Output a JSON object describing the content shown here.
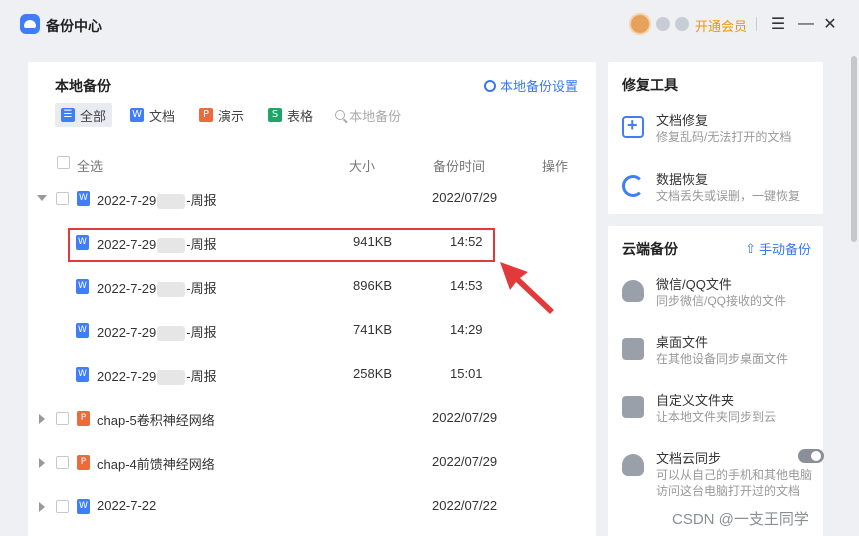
{
  "app": {
    "title": "备份中心"
  },
  "titlebar": {
    "vip_label": "开通会员",
    "menu_icon": "menu-icon",
    "min_icon": "minimize-icon",
    "close_icon": "close-icon"
  },
  "local": {
    "title": "本地备份",
    "settings_label": "本地备份设置",
    "filters": [
      {
        "label": "全部",
        "icon": "list-icon",
        "color": "#3f7ef8",
        "glyph": "☰",
        "active": true
      },
      {
        "label": "文档",
        "icon": "word-icon",
        "color": "#3f7ef8",
        "glyph": "W",
        "active": false
      },
      {
        "label": "演示",
        "icon": "ppt-icon",
        "color": "#ee6a3c",
        "glyph": "P",
        "active": false
      },
      {
        "label": "表格",
        "icon": "sheet-icon",
        "color": "#1fa568",
        "glyph": "S",
        "active": false
      }
    ],
    "search_placeholder": "本地备份",
    "columns": {
      "select_all": "全选",
      "size": "大小",
      "time": "备份时间",
      "ops": "操作"
    },
    "rows": [
      {
        "name_pre": "2022-7-29",
        "name_post": "-周报",
        "size": "",
        "time": "2022/07/29",
        "type": "word",
        "level": 0,
        "caret": "open"
      },
      {
        "name_pre": "2022-7-29",
        "name_post": "-周报",
        "size": "941KB",
        "time": "14:52",
        "type": "word",
        "level": 1,
        "caret": ""
      },
      {
        "name_pre": "2022-7-29",
        "name_post": "-周报",
        "size": "896KB",
        "time": "14:53",
        "type": "word",
        "level": 1,
        "caret": ""
      },
      {
        "name_pre": "2022-7-29",
        "name_post": "-周报",
        "size": "741KB",
        "time": "14:29",
        "type": "word",
        "level": 1,
        "caret": ""
      },
      {
        "name_pre": "2022-7-29",
        "name_post": "-周报",
        "size": "258KB",
        "time": "15:01",
        "type": "word",
        "level": 1,
        "caret": ""
      },
      {
        "name_pre": "chap-5卷积神经网络",
        "name_post": "",
        "size": "",
        "time": "2022/07/29",
        "type": "ppt",
        "level": 0,
        "caret": "closed"
      },
      {
        "name_pre": "chap-4前馈神经网络",
        "name_post": "",
        "size": "",
        "time": "2022/07/29",
        "type": "ppt",
        "level": 0,
        "caret": "closed"
      },
      {
        "name_pre": "2022-7-22",
        "name_post": "",
        "size": "",
        "time": "2022/07/22",
        "type": "word",
        "level": 0,
        "caret": "closed"
      }
    ]
  },
  "repair": {
    "title": "修复工具",
    "tools": [
      {
        "title": "文档修复",
        "desc": "修复乱码/无法打开的文档",
        "icon": "document-repair-icon"
      },
      {
        "title": "数据恢复",
        "desc": "文档丢失或误删，一键恢复",
        "icon": "data-recovery-icon"
      }
    ]
  },
  "cloud": {
    "title": "云端备份",
    "manual_label": "手动备份",
    "items": [
      {
        "title": "微信/QQ文件",
        "desc": "同步微信/QQ接收的文件",
        "icon": "chat-icon"
      },
      {
        "title": "桌面文件",
        "desc": "在其他设备同步桌面文件",
        "icon": "desktop-icon"
      },
      {
        "title": "自定义文件夹",
        "desc": "让本地文件夹同步到云",
        "icon": "folder-icon"
      },
      {
        "title": "文档云同步",
        "desc": "可以从自己的手机和其他电脑",
        "desc2": "访问这台电脑打开过的文档",
        "icon": "cloud-upload-icon",
        "toggle": false
      }
    ]
  },
  "watermark": "CSDN @一支王同学"
}
